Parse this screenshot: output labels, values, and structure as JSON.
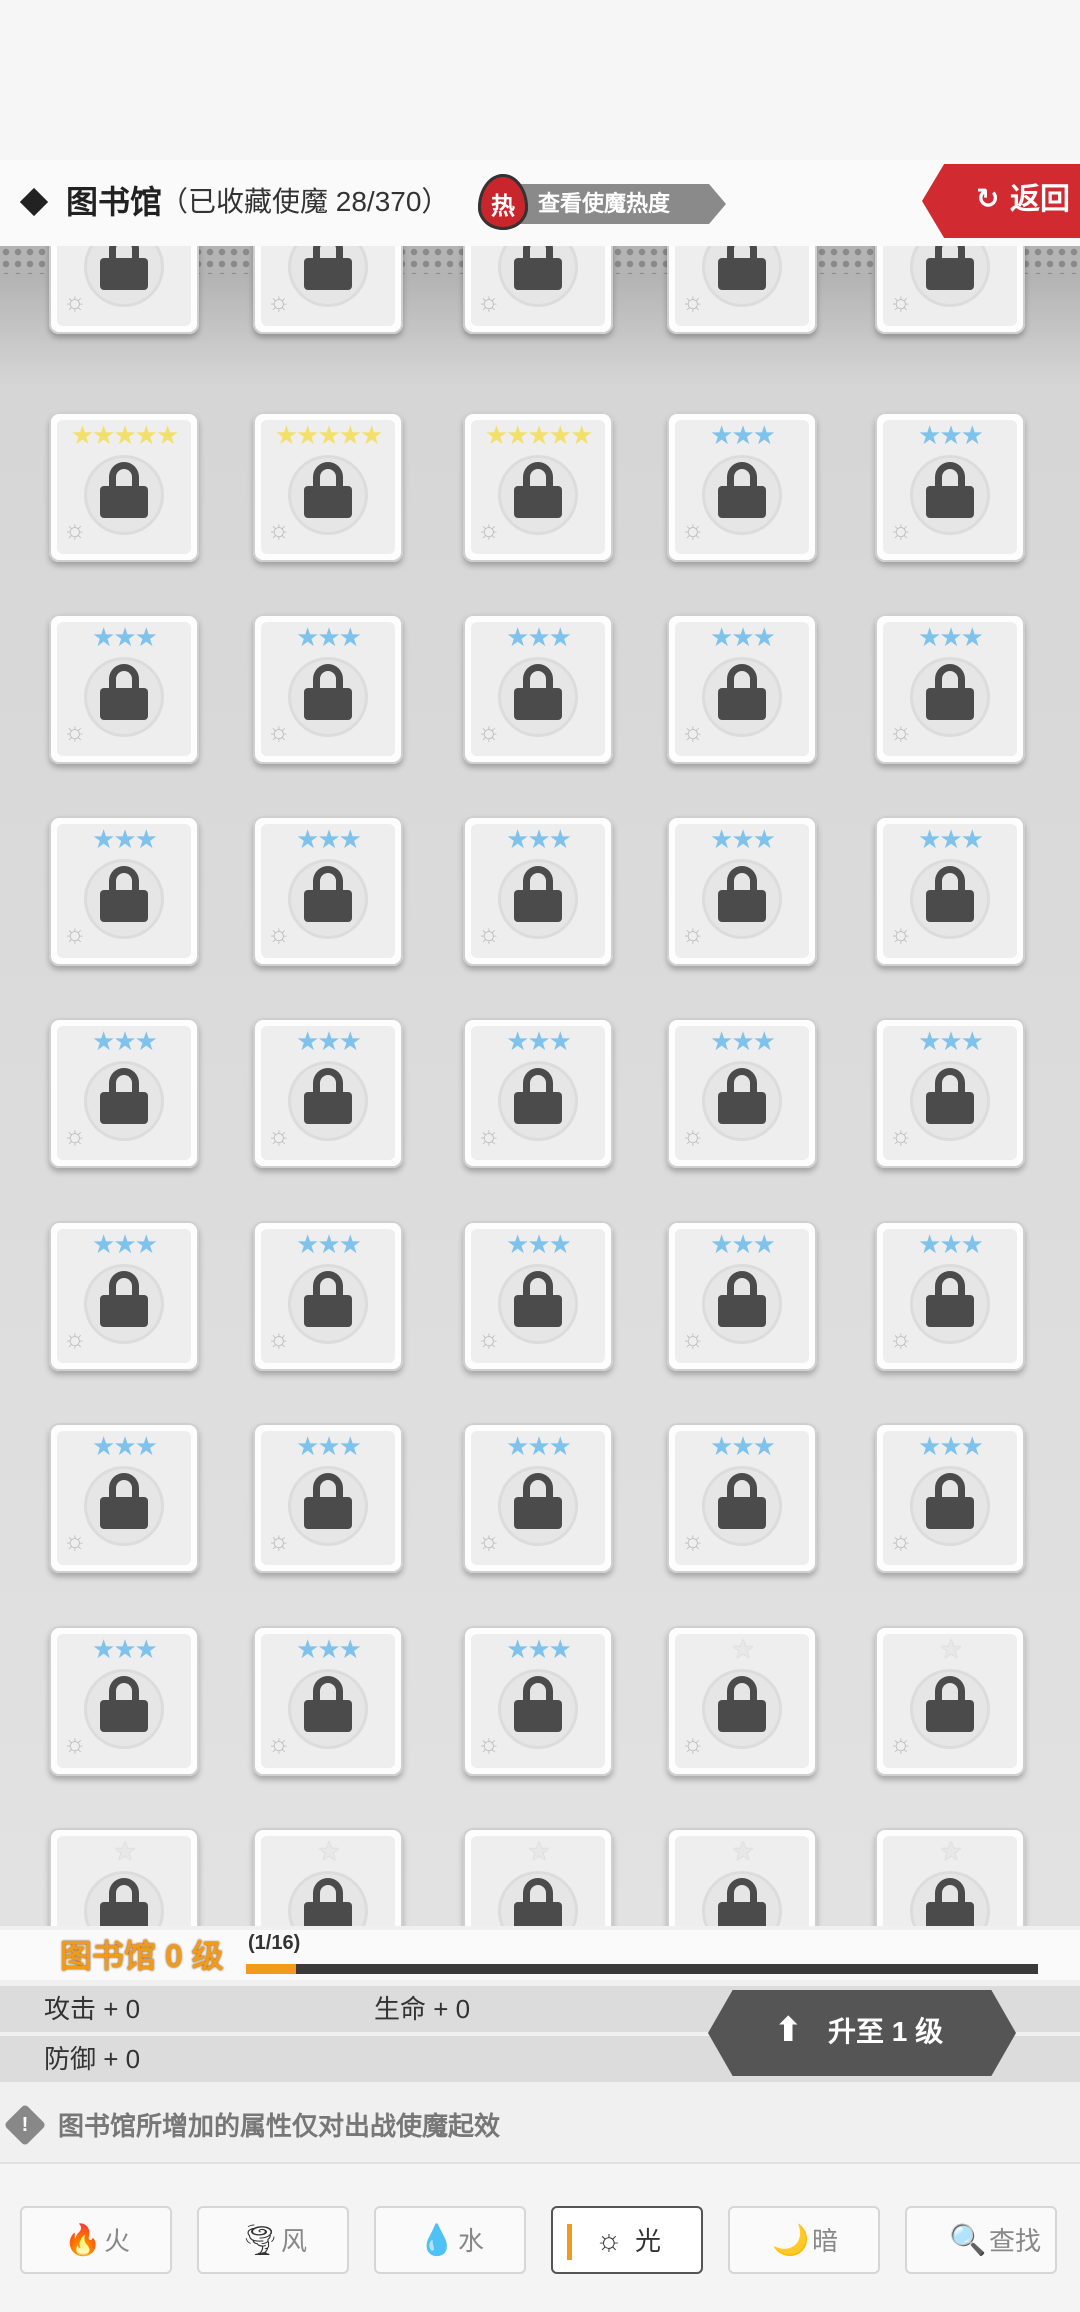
{
  "header": {
    "title": "图书馆",
    "collected": "（已收藏使魔 28/370）",
    "hot_icon": "热",
    "hot_label": "查看使魔热度",
    "back_label": "返回"
  },
  "colors": {
    "accent_orange": "#f19a1c",
    "back_red": "#d12b31",
    "hot_red": "#c8262c",
    "star_gold": "#f2e06b",
    "star_blue": "#7fc2ec"
  },
  "grid": {
    "rows": [
      {
        "stars": [
          "none",
          "none",
          "none",
          "none",
          "none"
        ]
      },
      {
        "stars": [
          "5-gold",
          "5-gold",
          "5-gold",
          "3-blue",
          "3-blue"
        ]
      },
      {
        "stars": [
          "3-blue",
          "3-blue",
          "3-blue",
          "3-blue",
          "3-blue"
        ]
      },
      {
        "stars": [
          "3-blue",
          "3-blue",
          "3-blue",
          "3-blue",
          "3-blue"
        ]
      },
      {
        "stars": [
          "3-blue",
          "3-blue",
          "3-blue",
          "3-blue",
          "3-blue"
        ]
      },
      {
        "stars": [
          "3-blue",
          "3-blue",
          "3-blue",
          "3-blue",
          "3-blue"
        ]
      },
      {
        "stars": [
          "3-blue",
          "3-blue",
          "3-blue",
          "3-blue",
          "3-blue"
        ]
      },
      {
        "stars": [
          "3-blue",
          "3-blue",
          "3-blue",
          "1-gray",
          "1-gray"
        ]
      },
      {
        "stars": [
          "1-gray",
          "1-gray",
          "1-gray",
          "1-gray",
          "1-gray"
        ]
      }
    ],
    "all_locked": true
  },
  "level": {
    "title": "图书馆 0 级",
    "count": "(1/16)",
    "progress_fraction": 0.0625
  },
  "stats": {
    "attack": "攻击 + 0",
    "life": "生命 + 0",
    "defense": "防御 + 0"
  },
  "upgrade": {
    "label": "升至 1 级"
  },
  "note": {
    "icon": "!",
    "text": "图书馆所增加的属性仅对出战使魔起效"
  },
  "tabs": [
    {
      "label": "火",
      "icon": "fire-icon",
      "glyph": "🔥",
      "active": false
    },
    {
      "label": "风",
      "icon": "wind-icon",
      "glyph": "🌪",
      "active": false
    },
    {
      "label": "水",
      "icon": "water-icon",
      "glyph": "💧",
      "active": false
    },
    {
      "label": "光",
      "icon": "light-icon",
      "glyph": "☼",
      "active": true
    },
    {
      "label": "暗",
      "icon": "dark-icon",
      "glyph": "🌙",
      "active": false
    },
    {
      "label": "查找",
      "icon": "search-icon",
      "glyph": "🔍",
      "active": false
    }
  ]
}
